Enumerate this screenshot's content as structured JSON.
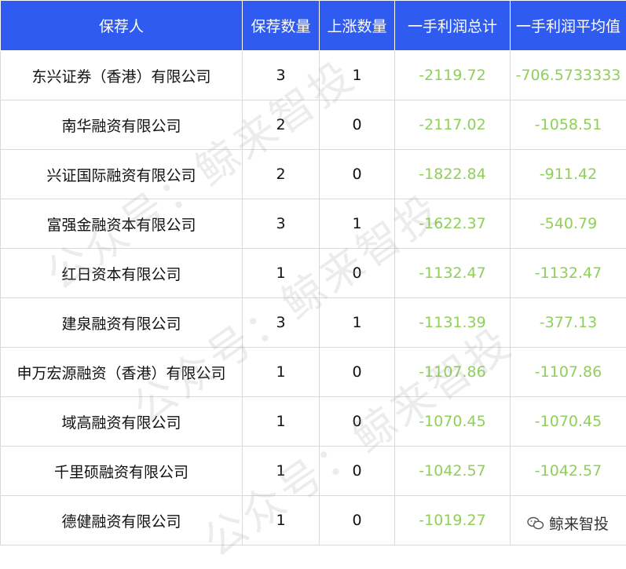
{
  "table": {
    "headers": [
      "保荐人",
      "保荐数量",
      "上涨数量",
      "一手利润总计",
      "一手利润平均值"
    ],
    "rows": [
      [
        "东兴证券（香港）有限公司",
        "3",
        "1",
        "-2119.72",
        "-706.5733333"
      ],
      [
        "南华融资有限公司",
        "2",
        "0",
        "-2117.02",
        "-1058.51"
      ],
      [
        "兴证国际融资有限公司",
        "2",
        "0",
        "-1822.84",
        "-911.42"
      ],
      [
        "富强金融资本有限公司",
        "3",
        "1",
        "-1622.37",
        "-540.79"
      ],
      [
        "红日资本有限公司",
        "1",
        "0",
        "-1132.47",
        "-1132.47"
      ],
      [
        "建泉融资有限公司",
        "3",
        "1",
        "-1131.39",
        "-377.13"
      ],
      [
        "申万宏源融资（香港）有限公司",
        "1",
        "0",
        "-1107.86",
        "-1107.86"
      ],
      [
        "域高融资有限公司",
        "1",
        "0",
        "-1070.45",
        "-1070.45"
      ],
      [
        "千里硕融资有限公司",
        "1",
        "0",
        "-1042.57",
        "-1042.57"
      ],
      [
        "德健融资有限公司",
        "1",
        "0",
        "-1019.27",
        ""
      ]
    ]
  },
  "watermark": {
    "text": "公众号：鲸来智投"
  },
  "logo": {
    "text": "鲸来智投",
    "icon": "wechat-icon"
  },
  "colors": {
    "header_bg": "#2f5bf0",
    "negative_text": "#8fcf5a",
    "border": "#d9d9d9"
  }
}
